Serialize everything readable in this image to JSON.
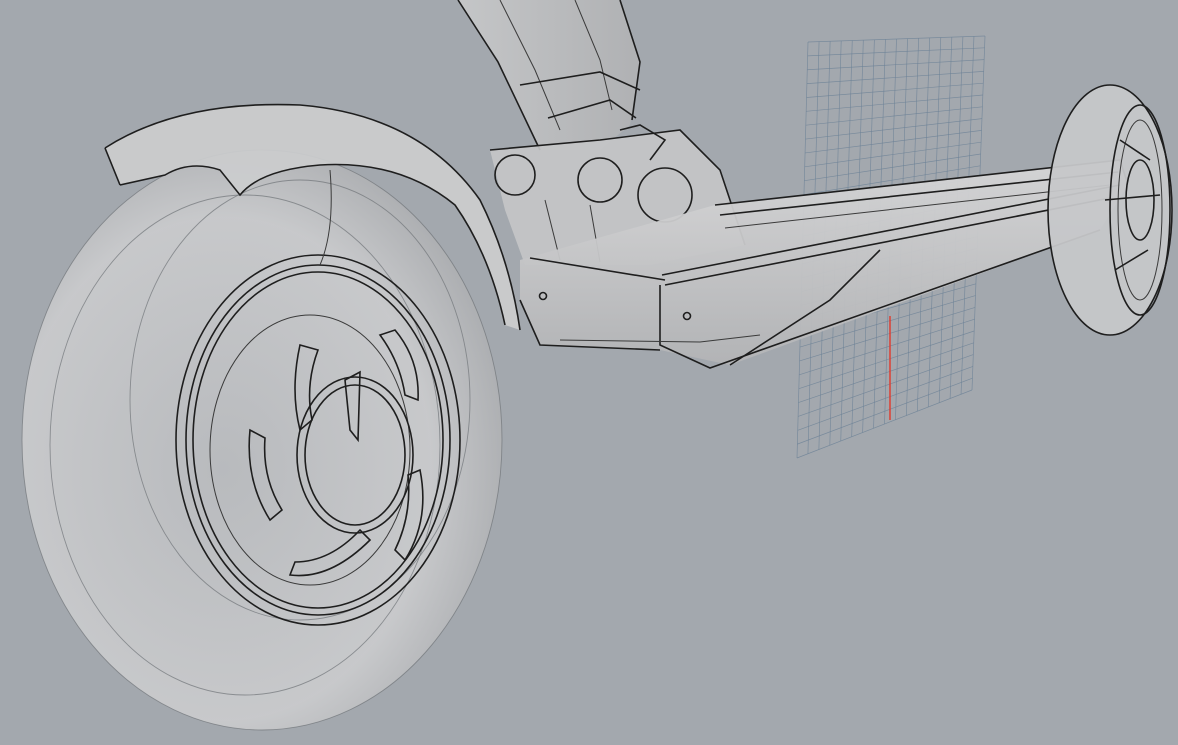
{
  "viewport": {
    "background_color": "#a3a8ae",
    "model_fill_color": "#cfd0d1",
    "edge_color": "#1e1e1e",
    "grid_color": "#6b8196",
    "axis_color": "#e0382c",
    "display_mode": "ghosted"
  },
  "scene": {
    "objects": [
      "scooter-rear-wheel-icon",
      "scooter-rear-fender-icon",
      "scooter-deck-icon",
      "scooter-stem-icon",
      "scooter-front-wheel-icon",
      "construction-grid-icon"
    ]
  }
}
